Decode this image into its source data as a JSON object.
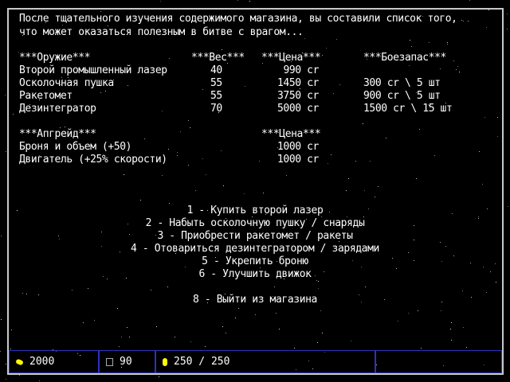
{
  "intro": [
    "После тщательного изучения содержимого магазина, вы составили список того,",
    "что может оказаться полезным в битве с врагом..."
  ],
  "weapons": {
    "headers": {
      "name": "***Оружие***",
      "weight": "***Вес***",
      "price": "***Цена***",
      "ammo": "***Боезапас***"
    },
    "rows": [
      {
        "name": "Второй промышленный лазер",
        "weight": "40",
        "price": "990 cr",
        "ammo": ""
      },
      {
        "name": "Осколочная пушка",
        "weight": "55",
        "price": "1450 cr",
        "ammo": "300 cr \\ 5 шт"
      },
      {
        "name": "Ракетомет",
        "weight": "55",
        "price": "3750 cr",
        "ammo": "900 cr \\ 5 шт"
      },
      {
        "name": "Дезинтегратор",
        "weight": "70",
        "price": "5000 cr",
        "ammo": "1500 cr \\ 15 шт"
      }
    ]
  },
  "upgrades": {
    "headers": {
      "name": "***Апгрейд***",
      "price": "***Цена***"
    },
    "rows": [
      {
        "name": "Броня и объем (+50)",
        "price": "1000 cr"
      },
      {
        "name": "Двигатель (+25% скорости)",
        "price": "1000 cr"
      }
    ]
  },
  "menu": [
    "1 - Купить второй лазер",
    "2 - Набыть осколочную пушку / снаряды",
    "3 - Приобрести ракетомет / ракеты",
    "4 - Отовариться дезинтегратором / зарядами",
    "5 - Укрепить броню",
    "6 - Улучшить движок",
    "8 - Выйти из магазина"
  ],
  "status": {
    "credits": "2000",
    "weight": "90",
    "energy": "250 / 250",
    "credits_icon": "coins-icon",
    "weight_icon": "cargo-icon",
    "energy_icon": "energy-icon"
  },
  "colors": {
    "accent": "#ffff00",
    "bar_border": "#3030c0"
  }
}
